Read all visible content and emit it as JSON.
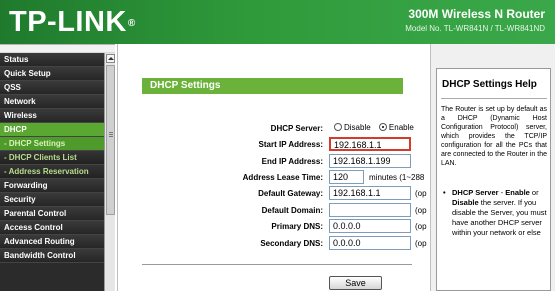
{
  "header": {
    "logo": "TP-LINK",
    "logo_mark": "®",
    "title": "300M Wireless N Router",
    "model": "Model No. TL-WR841N / TL-WR841ND"
  },
  "menu": {
    "items": [
      {
        "label": "Status"
      },
      {
        "label": "Quick Setup"
      },
      {
        "label": "QSS"
      },
      {
        "label": "Network"
      },
      {
        "label": "Wireless"
      },
      {
        "label": "DHCP"
      },
      {
        "label": "- DHCP Settings"
      },
      {
        "label": "- DHCP Clients List"
      },
      {
        "label": "- Address Reservation"
      },
      {
        "label": "Forwarding"
      },
      {
        "label": "Security"
      },
      {
        "label": "Parental Control"
      },
      {
        "label": "Access Control"
      },
      {
        "label": "Advanced Routing"
      },
      {
        "label": "Bandwidth Control"
      }
    ]
  },
  "main": {
    "section_title": "DHCP Settings",
    "dhcp_server": {
      "label": "DHCP Server:",
      "options": [
        "Disable",
        "Enable"
      ],
      "selected": "Enable"
    },
    "start_ip": {
      "label": "Start IP Address:",
      "value": "192.168.1.1"
    },
    "end_ip": {
      "label": "End IP Address:",
      "value": "192.168.1.199"
    },
    "lease_time": {
      "label": "Address Lease Time:",
      "value": "120",
      "suffix": "minutes (1~288"
    },
    "gateway": {
      "label": "Default Gateway:",
      "value": "192.168.1.1",
      "suffix": "(op"
    },
    "domain": {
      "label": "Default Domain:",
      "value": "",
      "suffix": "(op"
    },
    "primary_dns": {
      "label": "Primary DNS:",
      "value": "0.0.0.0",
      "suffix": "(op"
    },
    "secondary_dns": {
      "label": "Secondary DNS:",
      "value": "0.0.0.0",
      "suffix": "(op"
    },
    "save_label": "Save"
  },
  "help": {
    "title": "DHCP Settings Help",
    "intro": "The Router is set up by default as a DHCP (Dynamic Host Configuration Protocol) server, which provides the TCP/IP configuration for all the PCs that are connected to the Router in the LAN.",
    "bullet_bullet": "•",
    "bullet_term": "DHCP Server",
    "bullet_dash": " - ",
    "bullet_enable": "Enable",
    "bullet_or": " or ",
    "bullet_disable": "Disable",
    "bullet_rest": " the server. If you disable the Server, you must have another DHCP server within your network or else"
  },
  "colors": {
    "header_green": "#2f9a3a",
    "menu_active": "#5aa832",
    "section_green": "#6ab23a",
    "highlight_red": "#d23c2c"
  }
}
